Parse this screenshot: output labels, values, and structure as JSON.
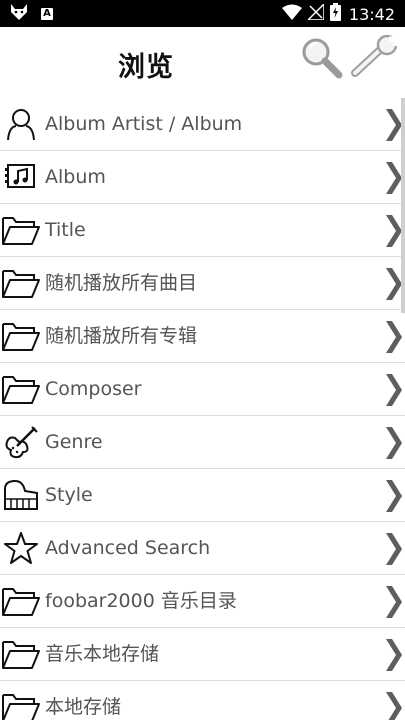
{
  "status_bar": {
    "time": "13:42",
    "left_icons": [
      "fox-icon",
      "a-notification-icon"
    ],
    "right_icons": [
      "wifi-icon",
      "signal-off-icon",
      "battery-charging-icon"
    ]
  },
  "header": {
    "title": "浏览",
    "search_icon": "magnifier-icon",
    "settings_icon": "wrench-icon"
  },
  "browse_items": [
    {
      "label": "Album Artist / Album",
      "icon": "person-icon"
    },
    {
      "label": "Album",
      "icon": "album-icon"
    },
    {
      "label": "Title",
      "icon": "folder-icon"
    },
    {
      "label": "随机播放所有曲目",
      "icon": "folder-icon"
    },
    {
      "label": "随机播放所有专辑",
      "icon": "folder-icon"
    },
    {
      "label": "Composer",
      "icon": "folder-icon"
    },
    {
      "label": "Genre",
      "icon": "violin-icon"
    },
    {
      "label": "Style",
      "icon": "piano-icon"
    },
    {
      "label": "Advanced Search",
      "icon": "star-icon"
    },
    {
      "label": "foobar2000 音乐目录",
      "icon": "folder-icon"
    },
    {
      "label": "音乐本地存储",
      "icon": "folder-icon"
    },
    {
      "label": "本地存储",
      "icon": "folder-icon"
    }
  ]
}
